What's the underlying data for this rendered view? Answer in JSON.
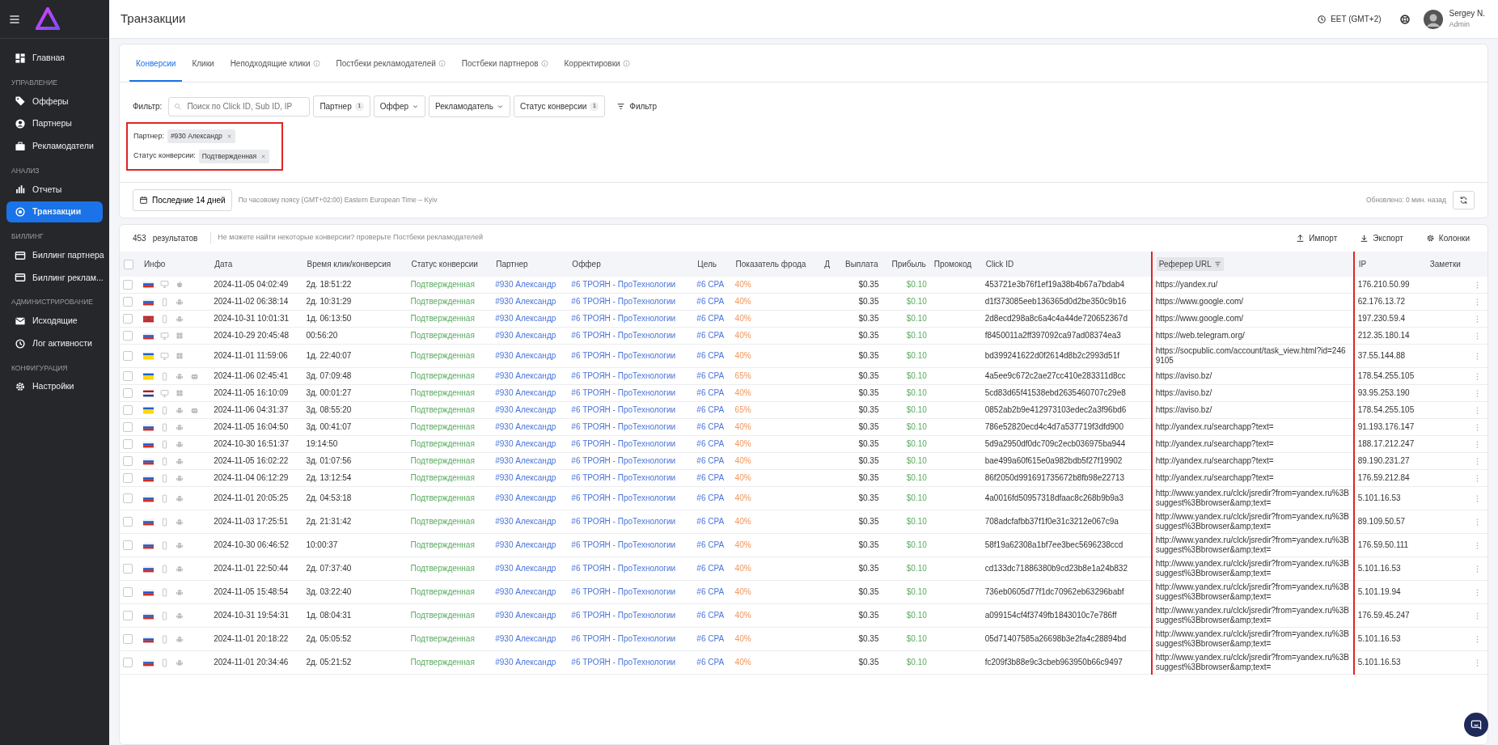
{
  "sidebar": {
    "sections": [
      {
        "items": [
          {
            "label": "Главная",
            "selected": false
          }
        ]
      },
      {
        "title": "УПРАВЛЕНИЕ",
        "items": [
          {
            "label": "Офферы",
            "selected": false
          },
          {
            "label": "Партнеры",
            "selected": false
          },
          {
            "label": "Рекламодатели",
            "selected": false
          }
        ]
      },
      {
        "title": "АНАЛИЗ",
        "items": [
          {
            "label": "Отчеты",
            "selected": false
          },
          {
            "label": "Транзакции",
            "selected": true
          }
        ]
      },
      {
        "title": "БИЛЛИНГ",
        "items": [
          {
            "label": "Биллинг партнера",
            "selected": false
          },
          {
            "label": "Биллинг реклам...",
            "selected": false
          }
        ]
      },
      {
        "title": "АДМИНИСТРИРОВАНИЕ",
        "items": [
          {
            "label": "Исходящие",
            "selected": false
          },
          {
            "label": "Лог активности",
            "selected": false
          }
        ]
      },
      {
        "title": "КОНФИГУРАЦИЯ",
        "items": [
          {
            "label": "Настройки",
            "selected": false
          }
        ]
      }
    ]
  },
  "header": {
    "title": "Транзакции",
    "timezone": "EET (GMT+2)",
    "user_name": "Sergey N.",
    "user_role": "Admin"
  },
  "tabs": [
    {
      "label": "Конверсии",
      "info": false,
      "selected": true
    },
    {
      "label": "Клики",
      "info": false,
      "selected": false
    },
    {
      "label": "Неподходящие клики",
      "info": true,
      "selected": false
    },
    {
      "label": "Постбеки рекламодателей",
      "info": true,
      "selected": false
    },
    {
      "label": "Постбеки партнеров",
      "info": true,
      "selected": false
    },
    {
      "label": "Корректировки",
      "info": true,
      "selected": false
    }
  ],
  "filter": {
    "label": "Фильтр:",
    "search_placeholder": "Поиск по Click ID, Sub ID, IP",
    "buttons": [
      {
        "label": "Партнер",
        "count": "1"
      },
      {
        "label": "Оффер"
      },
      {
        "label": "Рекламодатель"
      },
      {
        "label": "Статус конверсии",
        "count": "1"
      }
    ],
    "more_label": "Фильтр",
    "applied": [
      {
        "label": "Партнер:",
        "value": "#930 Александр"
      },
      {
        "label": "Статус конверсии:",
        "value": "Подтвержденная"
      }
    ],
    "applied_highlighted": true
  },
  "period": {
    "button": "Последние 14 дней",
    "timezone_note": "По часовому поясу (GMT+02:00) Eastern European Time – Kyiv",
    "updated": "Обновлено: 0 мин. назад"
  },
  "results": {
    "count": "453",
    "count_label": "результатов",
    "hint": "Не можете найти некоторые конверсии? проверьте Постбеки рекламодателей",
    "actions": [
      {
        "label": "Импорт",
        "kind": "upload"
      },
      {
        "label": "Экспорт",
        "kind": "download"
      },
      {
        "label": "Колонки",
        "kind": "gear"
      }
    ]
  },
  "table": {
    "header_checked": false,
    "columns": [
      {
        "label": "Инфо"
      },
      {
        "label": "Дата"
      },
      {
        "label": "Время клик/конверсия"
      },
      {
        "label": "Статус конверсии"
      },
      {
        "label": "Партнер"
      },
      {
        "label": "Оффер"
      },
      {
        "label": "Цель"
      },
      {
        "label": "Показатель фрода"
      },
      {
        "label": "Д"
      },
      {
        "label": "Выплата"
      },
      {
        "label": "Прибыль"
      },
      {
        "label": "Промокод"
      },
      {
        "label": "Click ID"
      },
      {
        "label": "Реферер URL",
        "sorted": true,
        "highlighted": true
      },
      {
        "label": "IP"
      },
      {
        "label": "Заметки"
      }
    ],
    "rows": [
      {
        "checked": false,
        "info": [
          {
            "kind": "russia"
          },
          {
            "kind": "desktop"
          },
          {
            "kind": "apple"
          }
        ],
        "date": "2024-11-05 04:02:49",
        "time": "2д. 18:51:22",
        "status": "Подтвержденная",
        "partner": "#930  Александр",
        "offer": "#6  ТРОЯН - ПроТехнологии",
        "goal": "#6  CPA",
        "fraud": "40%",
        "payout": "$0.35",
        "profit": "$0.10",
        "click_id": "453721e3b76f1ef19a38b4b67a7bdab4",
        "referer": "https://yandex.ru/",
        "ip": "176.210.50.99"
      },
      {
        "checked": false,
        "info": [
          {
            "kind": "russia"
          },
          {
            "kind": "mobile"
          },
          {
            "kind": "android"
          }
        ],
        "date": "2024-11-02 06:38:14",
        "time": "2д. 10:31:29",
        "status": "Подтвержденная",
        "partner": "#930  Александр",
        "offer": "#6  ТРОЯН - ПроТехнологии",
        "goal": "#6  CPA",
        "fraud": "40%",
        "payout": "$0.35",
        "profit": "$0.10",
        "click_id": "d1f373085eeb136365d0d2be350c9b16",
        "referer": "https://www.google.com/",
        "ip": "62.176.13.72"
      },
      {
        "checked": false,
        "info": [
          {
            "kind": "morocco"
          },
          {
            "kind": "mobile"
          },
          {
            "kind": "android"
          }
        ],
        "date": "2024-10-31 10:01:31",
        "time": "1д. 06:13:50",
        "status": "Подтвержденная",
        "partner": "#930  Александр",
        "offer": "#6  ТРОЯН - ПроТехнологии",
        "goal": "#6  CPA",
        "fraud": "40%",
        "payout": "$0.35",
        "profit": "$0.10",
        "click_id": "2d8ecd298a8c6a4c4a44de720652367d",
        "referer": "https://www.google.com/",
        "ip": "197.230.59.4"
      },
      {
        "checked": false,
        "info": [
          {
            "kind": "russia"
          },
          {
            "kind": "desktop"
          },
          {
            "kind": "windows"
          }
        ],
        "date": "2024-10-29 20:45:48",
        "time": "00:56:20",
        "status": "Подтвержденная",
        "partner": "#930  Александр",
        "offer": "#6  ТРОЯН - ПроТехнологии",
        "goal": "#6  CPA",
        "fraud": "40%",
        "payout": "$0.35",
        "profit": "$0.10",
        "click_id": "f8450011a2ff397092ca97ad08374ea3",
        "referer": "https://web.telegram.org/",
        "ip": "212.35.180.14"
      },
      {
        "checked": false,
        "info": [
          {
            "kind": "ukraine"
          },
          {
            "kind": "desktop"
          },
          {
            "kind": "windows"
          }
        ],
        "date": "2024-11-01 11:59:06",
        "time": "1д. 22:40:07",
        "status": "Подтвержденная",
        "partner": "#930  Александр",
        "offer": "#6  ТРОЯН - ПроТехнологии",
        "goal": "#6  CPA",
        "fraud": "40%",
        "payout": "$0.35",
        "profit": "$0.10",
        "click_id": "bd399241622d0f2614d8b2c2993d51f",
        "referer": "https://socpublic.com/account/task_view.html?id=2469105",
        "ip": "37.55.144.88"
      },
      {
        "checked": false,
        "info": [
          {
            "kind": "ukraine"
          },
          {
            "kind": "mobile"
          },
          {
            "kind": "android"
          },
          {
            "kind": "robot"
          }
        ],
        "date": "2024-11-06 02:45:41",
        "time": "3д. 07:09:48",
        "status": "Подтвержденная",
        "partner": "#930  Александр",
        "offer": "#6  ТРОЯН - ПроТехнологии",
        "goal": "#6  CPA",
        "fraud": "65%",
        "payout": "$0.35",
        "profit": "$0.10",
        "click_id": "4a5ee9c672c2ae27cc410e283311d8cc",
        "referer": "https://aviso.bz/",
        "ip": "178.54.255.105"
      },
      {
        "checked": false,
        "info": [
          {
            "kind": "netherlands"
          },
          {
            "kind": "desktop"
          },
          {
            "kind": "windows"
          }
        ],
        "date": "2024-11-05 16:10:09",
        "time": "3д. 00:01:27",
        "status": "Подтвержденная",
        "partner": "#930  Александр",
        "offer": "#6  ТРОЯН - ПроТехнологии",
        "goal": "#6  CPA",
        "fraud": "40%",
        "payout": "$0.35",
        "profit": "$0.10",
        "click_id": "5cd83d65f41538ebd2635460707c29e8",
        "referer": "https://aviso.bz/",
        "ip": "93.95.253.190"
      },
      {
        "checked": false,
        "info": [
          {
            "kind": "ukraine"
          },
          {
            "kind": "mobile"
          },
          {
            "kind": "android"
          },
          {
            "kind": "robot"
          }
        ],
        "date": "2024-11-06 04:31:37",
        "time": "3д. 08:55:20",
        "status": "Подтвержденная",
        "partner": "#930  Александр",
        "offer": "#6  ТРОЯН - ПроТехнологии",
        "goal": "#6  CPA",
        "fraud": "65%",
        "payout": "$0.35",
        "profit": "$0.10",
        "click_id": "0852ab2b9e412973103edec2a3f96bd6",
        "referer": "https://aviso.bz/",
        "ip": "178.54.255.105"
      },
      {
        "checked": false,
        "info": [
          {
            "kind": "russia"
          },
          {
            "kind": "mobile"
          },
          {
            "kind": "android"
          }
        ],
        "date": "2024-11-05 16:04:50",
        "time": "3д. 00:41:07",
        "status": "Подтвержденная",
        "partner": "#930  Александр",
        "offer": "#6  ТРОЯН - ПроТехнологии",
        "goal": "#6  CPA",
        "fraud": "40%",
        "payout": "$0.35",
        "profit": "$0.10",
        "click_id": "786e52820ecd4c4d7a537719f3dfd900",
        "referer": "http://yandex.ru/searchapp?text=",
        "ip": "91.193.176.147"
      },
      {
        "checked": false,
        "info": [
          {
            "kind": "russia"
          },
          {
            "kind": "mobile"
          },
          {
            "kind": "android"
          }
        ],
        "date": "2024-10-30 16:51:37",
        "time": "19:14:50",
        "status": "Подтвержденная",
        "partner": "#930  Александр",
        "offer": "#6  ТРОЯН - ПроТехнологии",
        "goal": "#6  CPA",
        "fraud": "40%",
        "payout": "$0.35",
        "profit": "$0.10",
        "click_id": "5d9a2950df0dc709c2ecb036975ba944",
        "referer": "http://yandex.ru/searchapp?text=",
        "ip": "188.17.212.247"
      },
      {
        "checked": false,
        "info": [
          {
            "kind": "russia"
          },
          {
            "kind": "mobile"
          },
          {
            "kind": "android"
          }
        ],
        "date": "2024-11-05 16:02:22",
        "time": "3д. 01:07:56",
        "status": "Подтвержденная",
        "partner": "#930  Александр",
        "offer": "#6  ТРОЯН - ПроТехнологии",
        "goal": "#6  CPA",
        "fraud": "40%",
        "payout": "$0.35",
        "profit": "$0.10",
        "click_id": "bae499a60f615e0a982bdb5f27f19902",
        "referer": "http://yandex.ru/searchapp?text=",
        "ip": "89.190.231.27"
      },
      {
        "checked": false,
        "info": [
          {
            "kind": "russia"
          },
          {
            "kind": "mobile"
          },
          {
            "kind": "android"
          }
        ],
        "date": "2024-11-04 06:12:29",
        "time": "2д. 13:12:54",
        "status": "Подтвержденная",
        "partner": "#930  Александр",
        "offer": "#6  ТРОЯН - ПроТехнологии",
        "goal": "#6  CPA",
        "fraud": "40%",
        "payout": "$0.35",
        "profit": "$0.10",
        "click_id": "86f2050d991691735672b8fb98e22713",
        "referer": "http://yandex.ru/searchapp?text=",
        "ip": "176.59.212.84"
      },
      {
        "checked": false,
        "info": [
          {
            "kind": "russia"
          },
          {
            "kind": "mobile"
          },
          {
            "kind": "android"
          }
        ],
        "date": "2024-11-01 20:05:25",
        "time": "2д. 04:53:18",
        "status": "Подтвержденная",
        "partner": "#930  Александр",
        "offer": "#6  ТРОЯН - ПроТехнологии",
        "goal": "#6  CPA",
        "fraud": "40%",
        "payout": "$0.35",
        "profit": "$0.10",
        "click_id": "4a0016fd50957318dfaac8c268b9b9a3",
        "referer": "http://www.yandex.ru/clck/jsredir?from=yandex.ru%3Bsuggest%3Bbrowser&amp;text=",
        "ip": "5.101.16.53"
      },
      {
        "checked": false,
        "info": [
          {
            "kind": "russia"
          },
          {
            "kind": "mobile"
          },
          {
            "kind": "android"
          }
        ],
        "date": "2024-11-03 17:25:51",
        "time": "2д. 21:31:42",
        "status": "Подтвержденная",
        "partner": "#930  Александр",
        "offer": "#6  ТРОЯН - ПроТехнологии",
        "goal": "#6  CPA",
        "fraud": "40%",
        "payout": "$0.35",
        "profit": "$0.10",
        "click_id": "708adcfafbb37f1f0e31c3212e067c9a",
        "referer": "http://www.yandex.ru/clck/jsredir?from=yandex.ru%3Bsuggest%3Bbrowser&amp;text=",
        "ip": "89.109.50.57"
      },
      {
        "checked": false,
        "info": [
          {
            "kind": "russia"
          },
          {
            "kind": "mobile"
          },
          {
            "kind": "android"
          }
        ],
        "date": "2024-10-30 06:46:52",
        "time": "10:00:37",
        "status": "Подтвержденная",
        "partner": "#930  Александр",
        "offer": "#6  ТРОЯН - ПроТехнологии",
        "goal": "#6  CPA",
        "fraud": "40%",
        "payout": "$0.35",
        "profit": "$0.10",
        "click_id": "58f19a62308a1bf7ee3bec5696238ccd",
        "referer": "http://www.yandex.ru/clck/jsredir?from=yandex.ru%3Bsuggest%3Bbrowser&amp;text=",
        "ip": "176.59.50.111"
      },
      {
        "checked": false,
        "info": [
          {
            "kind": "russia"
          },
          {
            "kind": "mobile"
          },
          {
            "kind": "android"
          }
        ],
        "date": "2024-11-01 22:50:44",
        "time": "2д. 07:37:40",
        "status": "Подтвержденная",
        "partner": "#930  Александр",
        "offer": "#6  ТРОЯН - ПроТехнологии",
        "goal": "#6  CPA",
        "fraud": "40%",
        "payout": "$0.35",
        "profit": "$0.10",
        "click_id": "cd133dc71886380b9cd23b8e1a24b832",
        "referer": "http://www.yandex.ru/clck/jsredir?from=yandex.ru%3Bsuggest%3Bbrowser&amp;text=",
        "ip": "5.101.16.53"
      },
      {
        "checked": false,
        "info": [
          {
            "kind": "russia"
          },
          {
            "kind": "mobile"
          },
          {
            "kind": "android"
          }
        ],
        "date": "2024-11-05 15:48:54",
        "time": "3д. 03:22:40",
        "status": "Подтвержденная",
        "partner": "#930  Александр",
        "offer": "#6  ТРОЯН - ПроТехнологии",
        "goal": "#6  CPA",
        "fraud": "40%",
        "payout": "$0.35",
        "profit": "$0.10",
        "click_id": "736eb0605d77f1dc70962eb63296babf",
        "referer": "http://www.yandex.ru/clck/jsredir?from=yandex.ru%3Bsuggest%3Bbrowser&amp;text=",
        "ip": "5.101.19.94"
      },
      {
        "checked": false,
        "info": [
          {
            "kind": "russia"
          },
          {
            "kind": "mobile"
          },
          {
            "kind": "android"
          }
        ],
        "date": "2024-10-31 19:54:31",
        "time": "1д. 08:04:31",
        "status": "Подтвержденная",
        "partner": "#930  Александр",
        "offer": "#6  ТРОЯН - ПроТехнологии",
        "goal": "#6  CPA",
        "fraud": "40%",
        "payout": "$0.35",
        "profit": "$0.10",
        "click_id": "a099154cf4f3749fb1843010c7e786ff",
        "referer": "http://www.yandex.ru/clck/jsredir?from=yandex.ru%3Bsuggest%3Bbrowser&amp;text=",
        "ip": "176.59.45.247"
      },
      {
        "checked": false,
        "info": [
          {
            "kind": "russia"
          },
          {
            "kind": "mobile"
          },
          {
            "kind": "android"
          }
        ],
        "date": "2024-11-01 20:18:22",
        "time": "2д. 05:05:52",
        "status": "Подтвержденная",
        "partner": "#930  Александр",
        "offer": "#6  ТРОЯН - ПроТехнологии",
        "goal": "#6  CPA",
        "fraud": "40%",
        "payout": "$0.35",
        "profit": "$0.10",
        "click_id": "05d71407585a26698b3e2fa4c28894bd",
        "referer": "http://www.yandex.ru/clck/jsredir?from=yandex.ru%3Bsuggest%3Bbrowser&amp;text=",
        "ip": "5.101.16.53"
      },
      {
        "checked": false,
        "info": [
          {
            "kind": "russia"
          },
          {
            "kind": "mobile"
          },
          {
            "kind": "android"
          }
        ],
        "date": "2024-11-01 20:34:46",
        "time": "2д. 05:21:52",
        "status": "Подтвержденная",
        "partner": "#930  Александр",
        "offer": "#6  ТРОЯН - ПроТехнологии",
        "goal": "#6  CPA",
        "fraud": "40%",
        "payout": "$0.35",
        "profit": "$0.10",
        "click_id": "fc209f3b88e9c3cbeb963950b66c9497",
        "referer": "http://www.yandex.ru/clck/jsredir?from=yandex.ru%3Bsuggest%3Bbrowser&amp;text=",
        "ip": "5.101.16.53"
      }
    ]
  }
}
